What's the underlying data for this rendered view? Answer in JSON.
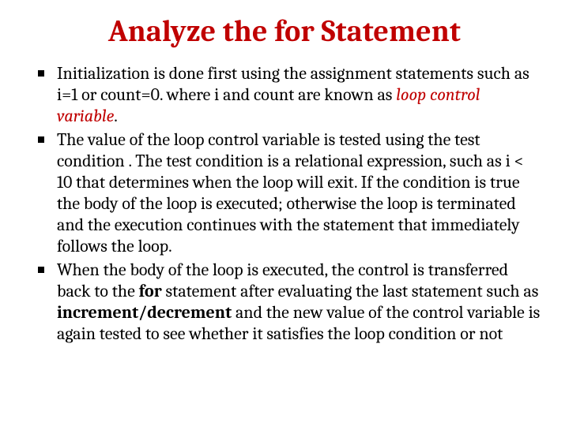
{
  "title": "Analyze the for Statement",
  "bullets": {
    "b1": {
      "t1": "Initialization is done first using the assignment statements such as i=1 or count=0.  where i and count are known as ",
      "em": "loop control variable",
      "t2": "."
    },
    "b2": {
      "t1": "The value of the loop control variable is tested using the test condition . The test condition is a relational expression, such as i < 10 that determines when the loop will exit. If the condition is true the body of the loop is executed; otherwise the loop is terminated and the execution continues with the statement that immediately follows the loop."
    },
    "b3": {
      "t1": "When the body of the loop is executed, the control is transferred back to the ",
      "bold1": "for",
      "t2": " statement after evaluating the last statement such as ",
      "bold2": "increment/decrement",
      "t3": " and the new value of the control variable is again tested to see whether it satisfies the loop condition or not"
    }
  }
}
